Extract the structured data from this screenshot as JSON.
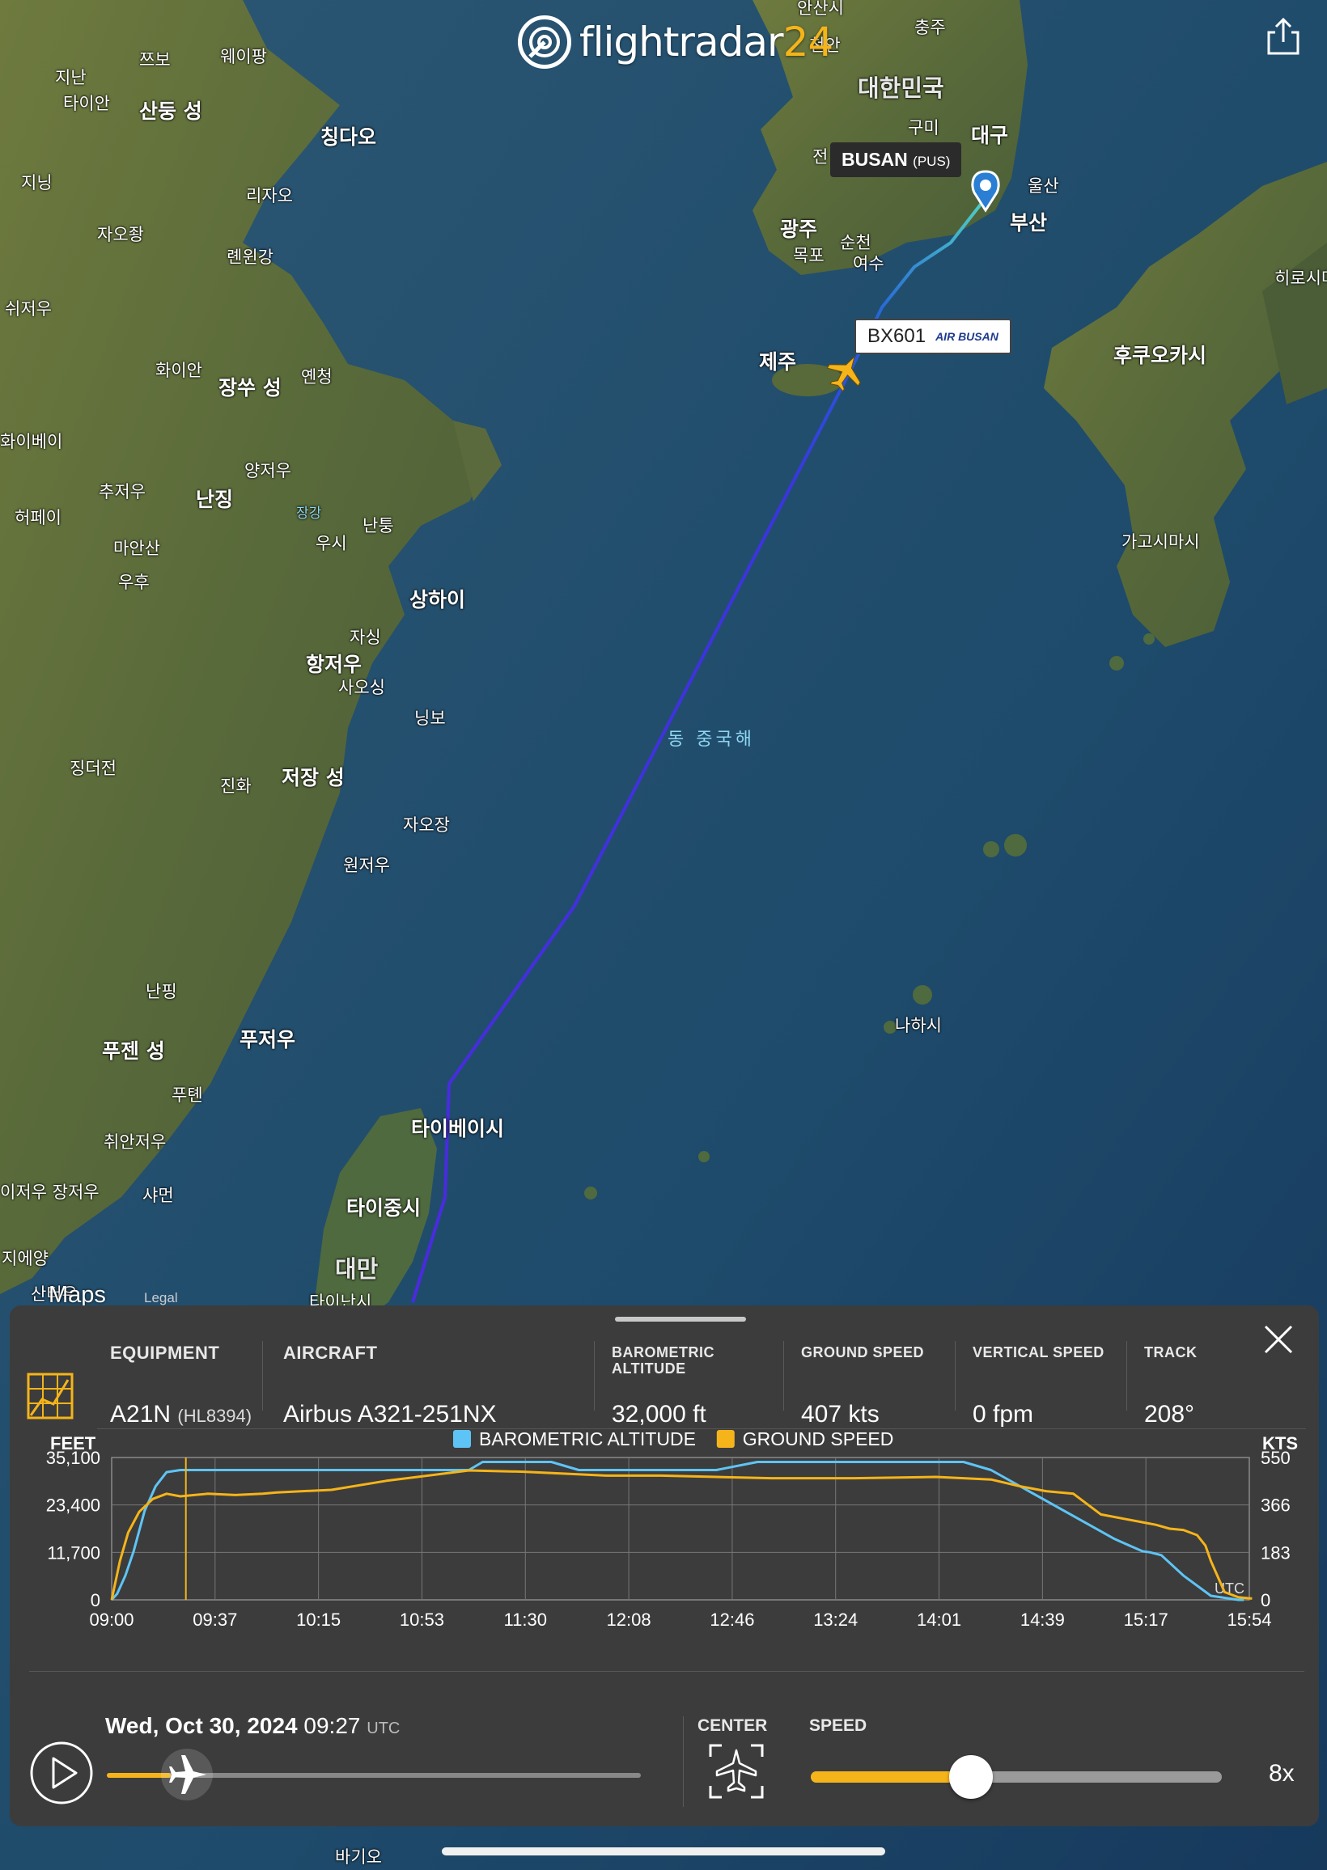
{
  "header": {
    "logo_text": "flightradar",
    "logo_number": "24",
    "share_icon": "share-icon"
  },
  "map": {
    "sea_label": "동 중국해",
    "labels": {
      "ansanshi": "안산시",
      "chungju": "충주",
      "cheonan": "천안",
      "korea": "대한민국",
      "gumi": "구미",
      "daegu": "대구",
      "ulsan": "울산",
      "busan_city": "부산",
      "gwangju": "광주",
      "suncheon": "순천",
      "mokpo": "목포",
      "yeosu": "여수",
      "jeon": "전",
      "jeju": "제주",
      "hiroshima": "히로시마",
      "fukuoka": "후쿠오카시",
      "kagoshima": "가고시마시",
      "naha": "나하시",
      "jinan": "지난",
      "zibo": "쯔보",
      "weifang": "웨이팡",
      "taian": "타이안",
      "shandong": "산둥 성",
      "qingdao": "칭다오",
      "jining": "지닝",
      "rizhao": "리자오",
      "zaozhuang": "자오좡",
      "lianyungang": "롄윈강",
      "xuzhou": "쉬저우",
      "huaian": "화이안",
      "jiangsu": "장쑤 성",
      "yancheng": "옌청",
      "huaibei": "화이베이",
      "yangzhou": "양저우",
      "chuzhou": "추저우",
      "nanjing": "난징",
      "hefei": "허페이",
      "changjiang": "장강",
      "nantong": "난퉁",
      "wuxi": "우시",
      "maanshan": "마안산",
      "wuhu": "우후",
      "shanghai": "상하이",
      "jiaxing": "자싱",
      "hangzhou": "항저우",
      "shaoxing": "사오싱",
      "ningbo": "닝보",
      "jingdezhen": "징더전",
      "jinhua": "진화",
      "zhejiang": "저장 성",
      "jiaozhuang": "자오장",
      "wenzhou": "원저우",
      "nanping": "난핑",
      "fujian": "푸젠 성",
      "fuzhou": "푸저우",
      "putian": "푸톈",
      "quanzhou": "취안저우",
      "zhangzhou": "이저우 장저우",
      "xiamen": "샤먼",
      "taipei": "타이베이시",
      "taichung": "타이중시",
      "taiwan": "대만",
      "tainan": "타이난시",
      "jieyang": "지에양",
      "shantou": "산터우",
      "kaohsiung": "바기오"
    },
    "origin_tag": {
      "name": "BUSAN",
      "code": "(PUS)"
    },
    "flight_tag": {
      "callsign": "BX601",
      "airline": "AIR BUSAN"
    },
    "maps_credit": "Maps",
    "legal": "Legal"
  },
  "panel": {
    "equipment": {
      "label": "EQUIPMENT",
      "value": "A21N",
      "reg": "(HL8394)"
    },
    "aircraft": {
      "label": "AIRCRAFT",
      "value": "Airbus A321-251NX"
    },
    "baro_alt": {
      "label1": "BAROMETRIC",
      "label2": "ALTITUDE",
      "value": "32,000 ft"
    },
    "ground_speed": {
      "label": "GROUND SPEED",
      "value": "407 kts"
    },
    "vertical_speed": {
      "label": "VERTICAL SPEED",
      "value": "0 fpm"
    },
    "track": {
      "label": "TRACK",
      "value": "208°"
    },
    "playback": {
      "date": "Wed, Oct 30, 2024",
      "time": "09:27",
      "tz": "UTC",
      "progress": 0.12
    },
    "center_label": "CENTER",
    "speed_label": "SPEED",
    "speed_value": "8x",
    "speed_fraction": 0.39
  },
  "chart_data": {
    "type": "line",
    "left_axis_label": "FEET",
    "right_axis_label": "KTS",
    "utc_label": "UTC",
    "y_left_ticks": [
      "35,100",
      "23,400",
      "11,700",
      "0"
    ],
    "y_right_ticks": [
      "550",
      "366",
      "183",
      "0"
    ],
    "x_ticks": [
      "09:00",
      "09:37",
      "10:15",
      "10:53",
      "11:30",
      "12:08",
      "12:46",
      "13:24",
      "14:01",
      "14:39",
      "15:17",
      "15:54"
    ],
    "ylim_left": [
      0,
      35100
    ],
    "ylim_right": [
      0,
      550
    ],
    "cursor_time_min": 27,
    "series": [
      {
        "name": "BAROMETRIC ALTITUDE",
        "color": "#5ec4f5",
        "x_min": [
          0,
          2,
          5,
          8,
          12,
          16,
          20,
          25,
          70,
          130,
          135,
          160,
          170,
          220,
          235,
          310,
          320,
          365,
          375,
          378,
          382,
          390,
          400,
          410,
          412
        ],
        "y": [
          0,
          1500,
          6000,
          12000,
          22000,
          28000,
          31500,
          32000,
          32000,
          32000,
          34000,
          34000,
          32000,
          32000,
          34000,
          34000,
          32000,
          15000,
          12000,
          11700,
          11000,
          6000,
          1000,
          0,
          0
        ]
      },
      {
        "name": "GROUND SPEED",
        "color": "#f5b419",
        "x_min": [
          0,
          3,
          6,
          10,
          15,
          20,
          25,
          35,
          45,
          55,
          60,
          80,
          100,
          130,
          150,
          180,
          200,
          240,
          270,
          300,
          320,
          330,
          340,
          350,
          360,
          370,
          375,
          380,
          385,
          390,
          395,
          398,
          400,
          405,
          410,
          415
        ],
        "y": [
          0,
          150,
          260,
          340,
          390,
          410,
          400,
          410,
          405,
          410,
          415,
          425,
          460,
          500,
          495,
          480,
          480,
          470,
          470,
          475,
          465,
          440,
          420,
          410,
          330,
          310,
          300,
          290,
          275,
          270,
          250,
          210,
          150,
          30,
          10,
          5
        ]
      }
    ],
    "x_range_min": [
      0,
      414
    ]
  },
  "colors": {
    "accent": "#f5b419",
    "panel_bg": "#3c3c3c",
    "route_purple": "#4b2adf",
    "route_blue": "#2563d9",
    "route_cyan": "#4fd1c5"
  }
}
